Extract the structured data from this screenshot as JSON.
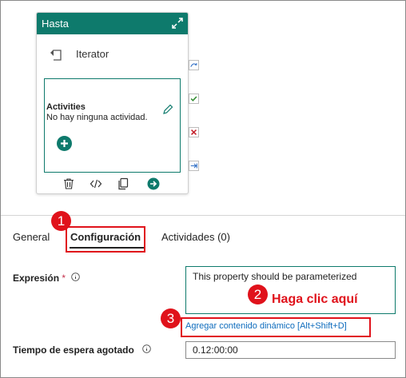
{
  "activity_card": {
    "title": "Hasta",
    "iterator_label": "Iterator",
    "inner": {
      "activities_title": "Activities",
      "activities_empty": "No hay ninguna actividad."
    },
    "toolbar_icons": [
      "delete-icon",
      "code-icon",
      "copy-icon",
      "arrow-right-icon"
    ]
  },
  "side_status_icons": [
    "skip-icon",
    "success-check-icon",
    "failure-x-icon",
    "completion-arrow-icon"
  ],
  "tabs": [
    {
      "label": "General"
    },
    {
      "label": "Configuración"
    },
    {
      "label": "Actividades (0)"
    }
  ],
  "callouts": {
    "badge1": "1",
    "badge2": "2",
    "badge3": "3",
    "hint": "Haga clic aquí"
  },
  "form": {
    "expression_label": "Expresión",
    "required_marker": "*",
    "expression_value": "This property should be parameterized",
    "dynamic_link": "Agregar contenido dinámico [Alt+Shift+D]",
    "timeout_label": "Tiempo de espera agotado",
    "timeout_value": "0.12:00:00"
  },
  "colors": {
    "accent": "#0e7a6c",
    "callout_red": "#e0121b",
    "link": "#0f6cbd"
  }
}
